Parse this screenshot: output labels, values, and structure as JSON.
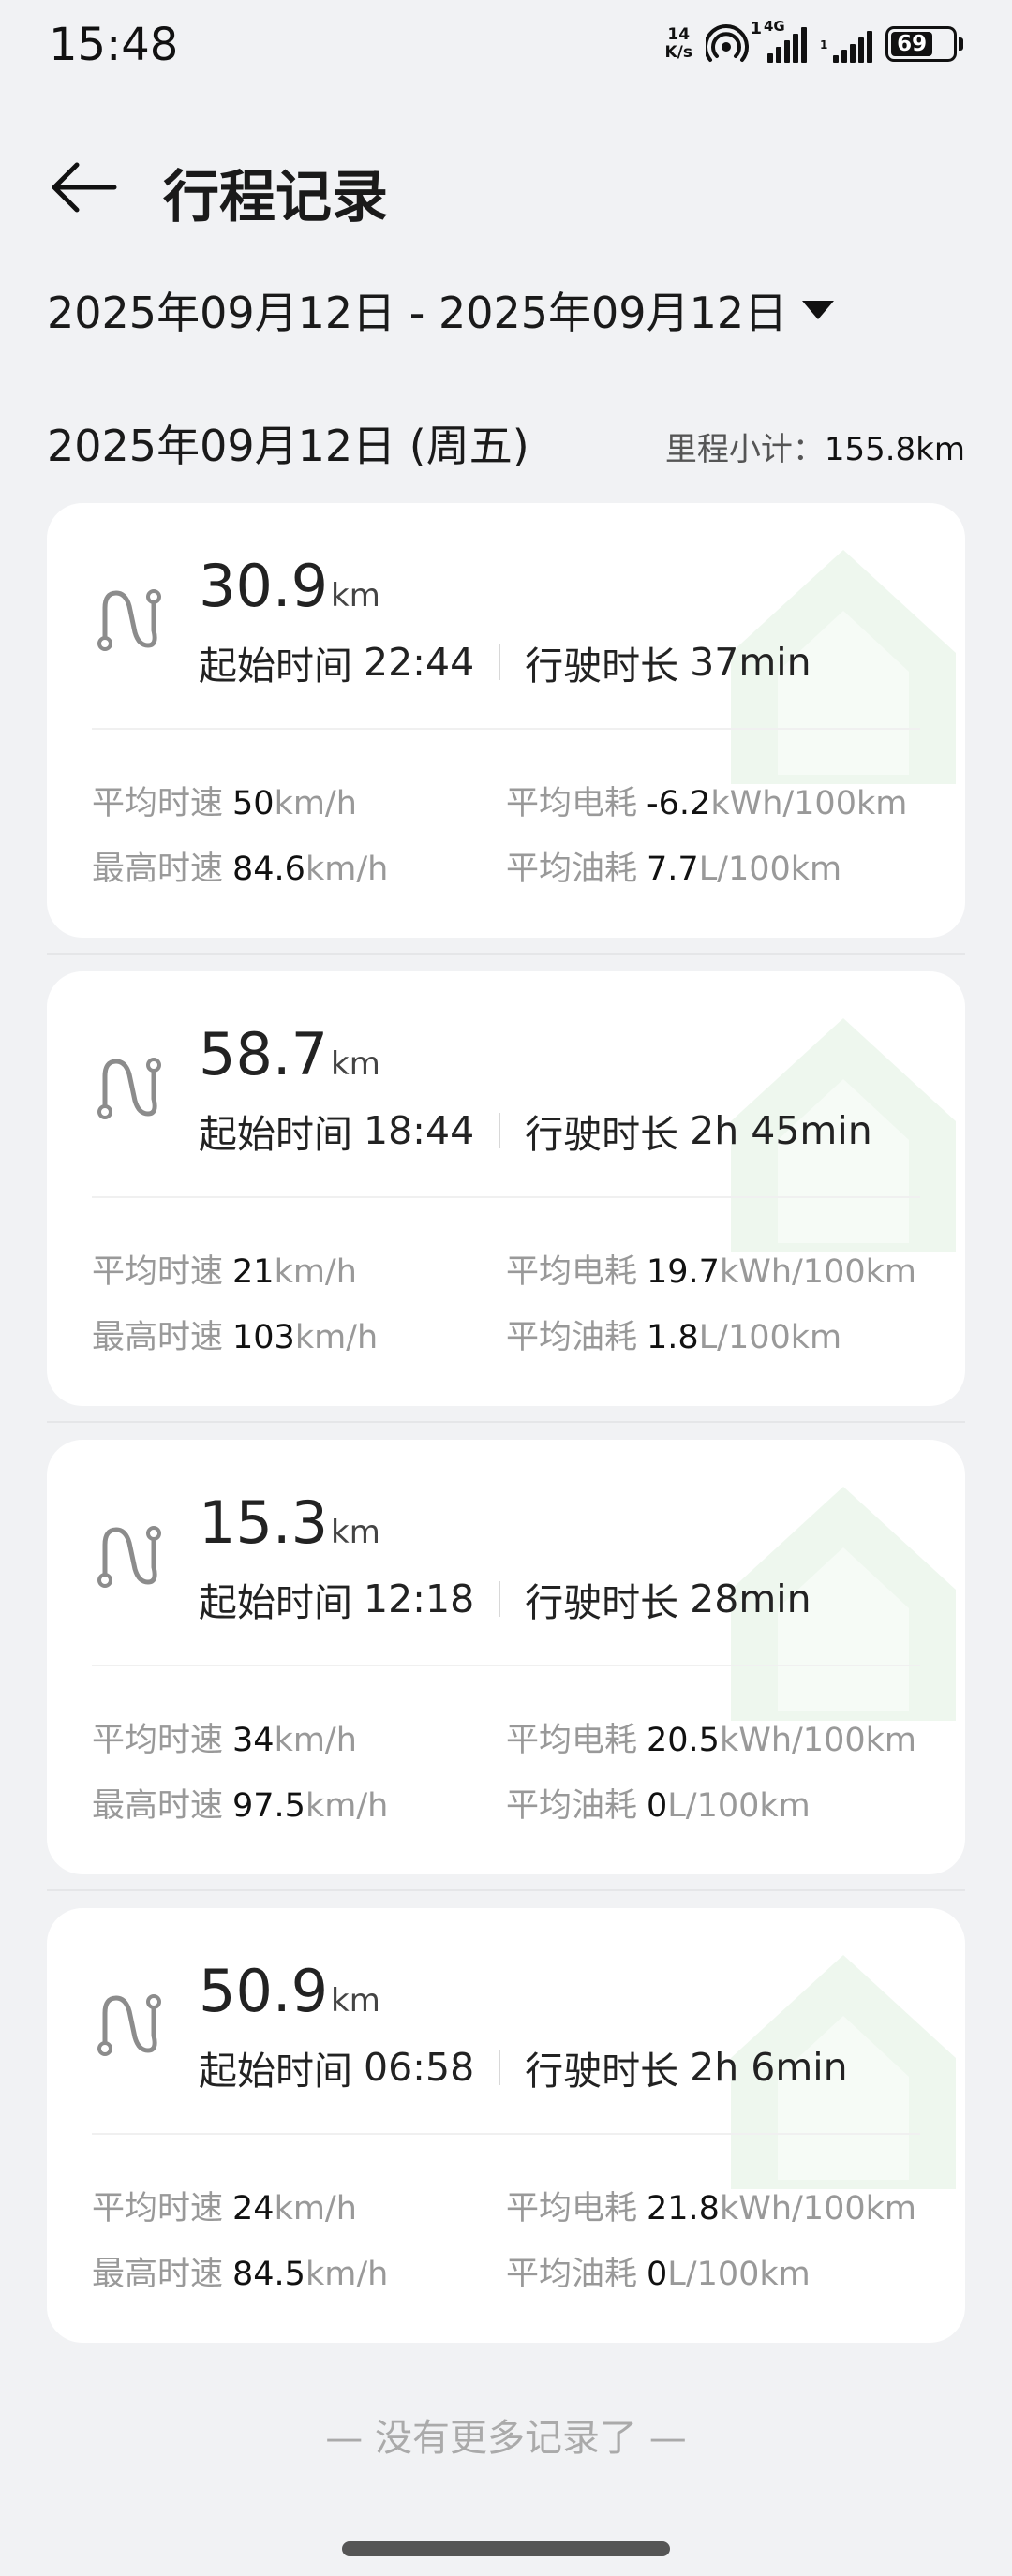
{
  "status_bar": {
    "time": "15:48",
    "net_speed_value": "14",
    "net_speed_unit": "K/s",
    "hotspot_count": "1",
    "signal_label": "4G",
    "signal2_label": "1",
    "battery_level": "69"
  },
  "header": {
    "title": "行程记录",
    "back_icon": "arrow-left-icon"
  },
  "date_range": {
    "label": "2025年09月12日 - 2025年09月12日",
    "dropdown_icon": "caret-down-icon"
  },
  "day": {
    "date": "2025年09月12日 (周五)",
    "summary_label": "里程小计：",
    "summary_value": "155.8km"
  },
  "labels": {
    "start_time": "起始时间",
    "duration": "行驶时长",
    "avg_speed": "平均时速",
    "max_speed": "最高时速",
    "avg_electric": "平均电耗",
    "avg_fuel": "平均油耗",
    "distance_unit": "km",
    "speed_unit": "km/h",
    "electric_unit": "kWh/100km",
    "fuel_unit": "L/100km"
  },
  "trips": [
    {
      "distance": "30.9",
      "start_time": "22:44",
      "duration": "37min",
      "avg_speed": "50",
      "max_speed": "84.6",
      "avg_electric": "-6.2",
      "avg_fuel": "7.7"
    },
    {
      "distance": "58.7",
      "start_time": "18:44",
      "duration": "2h 45min",
      "avg_speed": "21",
      "max_speed": "103",
      "avg_electric": "19.7",
      "avg_fuel": "1.8"
    },
    {
      "distance": "15.3",
      "start_time": "12:18",
      "duration": "28min",
      "avg_speed": "34",
      "max_speed": "97.5",
      "avg_electric": "20.5",
      "avg_fuel": "0"
    },
    {
      "distance": "50.9",
      "start_time": "06:58",
      "duration": "2h 6min",
      "avg_speed": "24",
      "max_speed": "84.5",
      "avg_electric": "21.8",
      "avg_fuel": "0"
    }
  ],
  "footer": {
    "no_more": "— 没有更多记录了 —"
  },
  "colors": {
    "background": "#f1f2f4",
    "card": "#ffffff",
    "muted_text": "#999999",
    "watermark": "#eef7ee"
  }
}
